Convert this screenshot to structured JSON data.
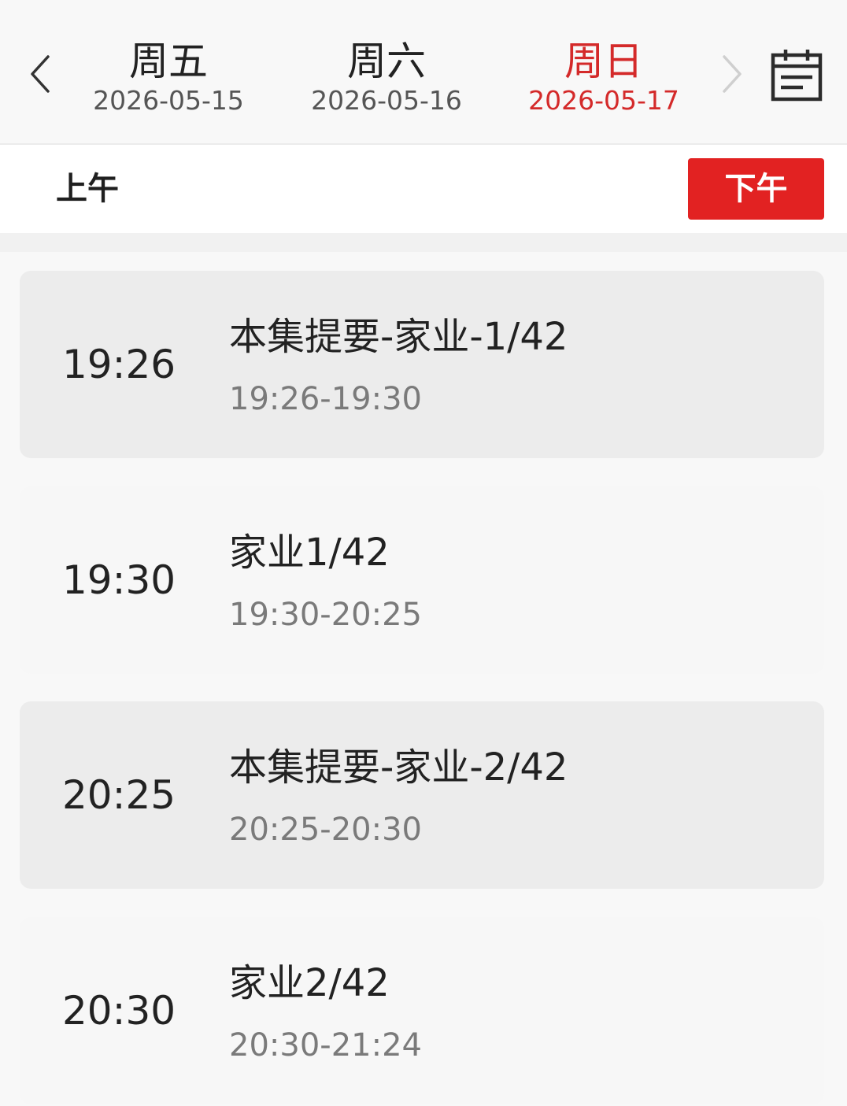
{
  "date_nav": {
    "prev_icon": "chevron-left-icon",
    "next_icon": "chevron-right-icon",
    "calendar_icon": "calendar-icon",
    "days": [
      {
        "weekday": "周五",
        "date": "2026-05-15",
        "selected": false
      },
      {
        "weekday": "周六",
        "date": "2026-05-16",
        "selected": false
      },
      {
        "weekday": "周日",
        "date": "2026-05-17",
        "selected": true
      }
    ]
  },
  "period_tabs": {
    "am_label": "上午",
    "pm_label": "下午",
    "active": "pm"
  },
  "programs": [
    {
      "start": "19:26",
      "title": "本集提要-家业-1/42",
      "range": "19:26-19:30",
      "shaded": true
    },
    {
      "start": "19:30",
      "title": "家业1/42",
      "range": "19:30-20:25",
      "shaded": false
    },
    {
      "start": "20:25",
      "title": "本集提要-家业-2/42",
      "range": "20:25-20:30",
      "shaded": true
    },
    {
      "start": "20:30",
      "title": "家业2/42",
      "range": "20:30-21:24",
      "shaded": false
    }
  ],
  "colors": {
    "accent": "#d42a2a",
    "active_tab_bg": "#e22222",
    "shaded_card": "#ececec"
  }
}
